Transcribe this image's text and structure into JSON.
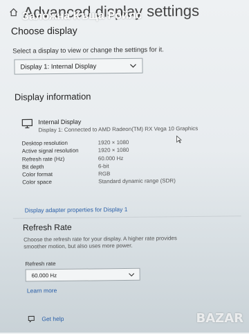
{
  "header": {
    "page_title": "Advanced display settings",
    "watermark_text": "Заложна Къща Ройлс"
  },
  "choose": {
    "heading": "Choose display",
    "help": "Select a display to view or change the settings for it.",
    "selected_display": "Display 1: Internal Display"
  },
  "info": {
    "heading": "Display information",
    "display_name": "Internal Display",
    "display_sub": "Display 1: Connected to AMD Radeon(TM) RX Vega 10 Graphics",
    "rows": [
      {
        "label": "Desktop resolution",
        "value": "1920 × 1080"
      },
      {
        "label": "Active signal resolution",
        "value": "1920 × 1080"
      },
      {
        "label": "Refresh rate (Hz)",
        "value": "60.000 Hz"
      },
      {
        "label": "Bit depth",
        "value": "6-bit"
      },
      {
        "label": "Color format",
        "value": "RGB"
      },
      {
        "label": "Color space",
        "value": "Standard dynamic range (SDR)"
      }
    ],
    "adapter_link": "Display adapter properties for Display 1"
  },
  "refresh": {
    "heading": "Refresh Rate",
    "description": "Choose the refresh rate for your display. A higher rate provides smoother motion, but also uses more power.",
    "label": "Refresh rate",
    "selected": "60.000 Hz",
    "learn_more": "Learn more"
  },
  "footer": {
    "help_link": "Get help",
    "brand": "BAZAR"
  },
  "colors": {
    "link": "#2a5fa8",
    "accent_divider": "#c9cfd3"
  }
}
